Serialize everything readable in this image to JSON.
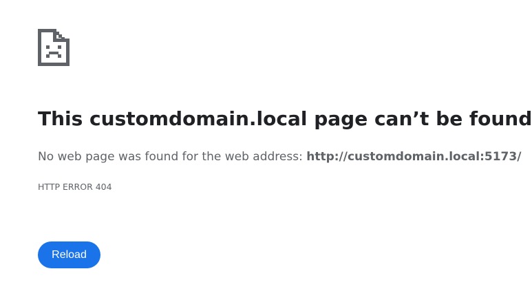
{
  "icon": {
    "name": "sad-document-icon"
  },
  "error": {
    "title_prefix": "This ",
    "title_host": "customdomain.local",
    "title_suffix": " page can’t be found",
    "message_prefix": "No web page was found for the web address: ",
    "message_url": "http://customdomain.local:5173/",
    "code": "HTTP ERROR 404"
  },
  "actions": {
    "reload_label": "Reload"
  },
  "colors": {
    "accent": "#1a73e8",
    "heading": "#202124",
    "secondary_text": "#5f6368",
    "icon": "#5f6368"
  }
}
